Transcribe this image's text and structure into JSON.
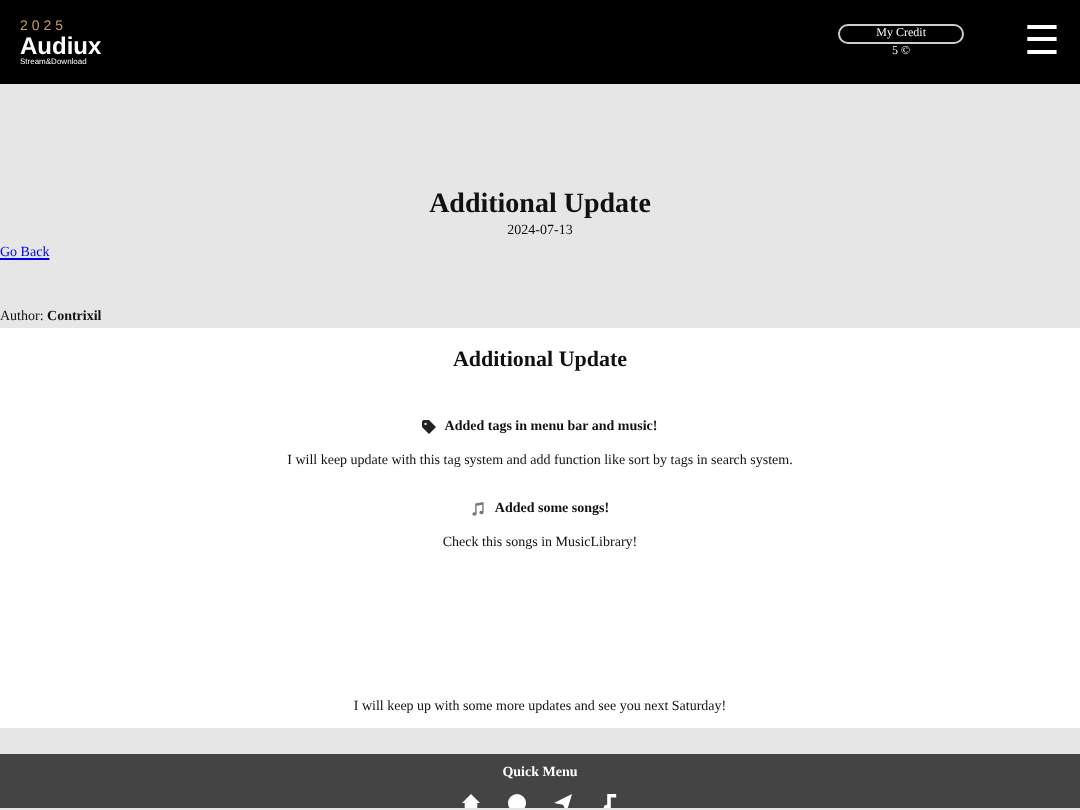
{
  "header": {
    "logo_title": "Audiux",
    "logo_year": "2025",
    "logo_subtitle": "Stream&Download",
    "credit_label": "My Credit",
    "credit_value": "5 ©",
    "menu_glyph": "☰"
  },
  "post": {
    "title": "Additional Update",
    "date": "2024-07-13",
    "back_link": "Go Back",
    "author_label": "Author:",
    "author": "Contrixil"
  },
  "article": {
    "heading": "Additional Update",
    "sections": [
      {
        "kind": "tag",
        "title": "Added tags in menu bar and music!",
        "body": "I will keep update with this tag system and add function like sort by tags in search system."
      },
      {
        "kind": "music",
        "title": "Added some songs!",
        "body": "Check this songs in MusicLibrary!"
      }
    ],
    "closing": "I will keep up with some more updates and see you next Saturday!"
  },
  "footer": {
    "title": "Quick Menu"
  }
}
